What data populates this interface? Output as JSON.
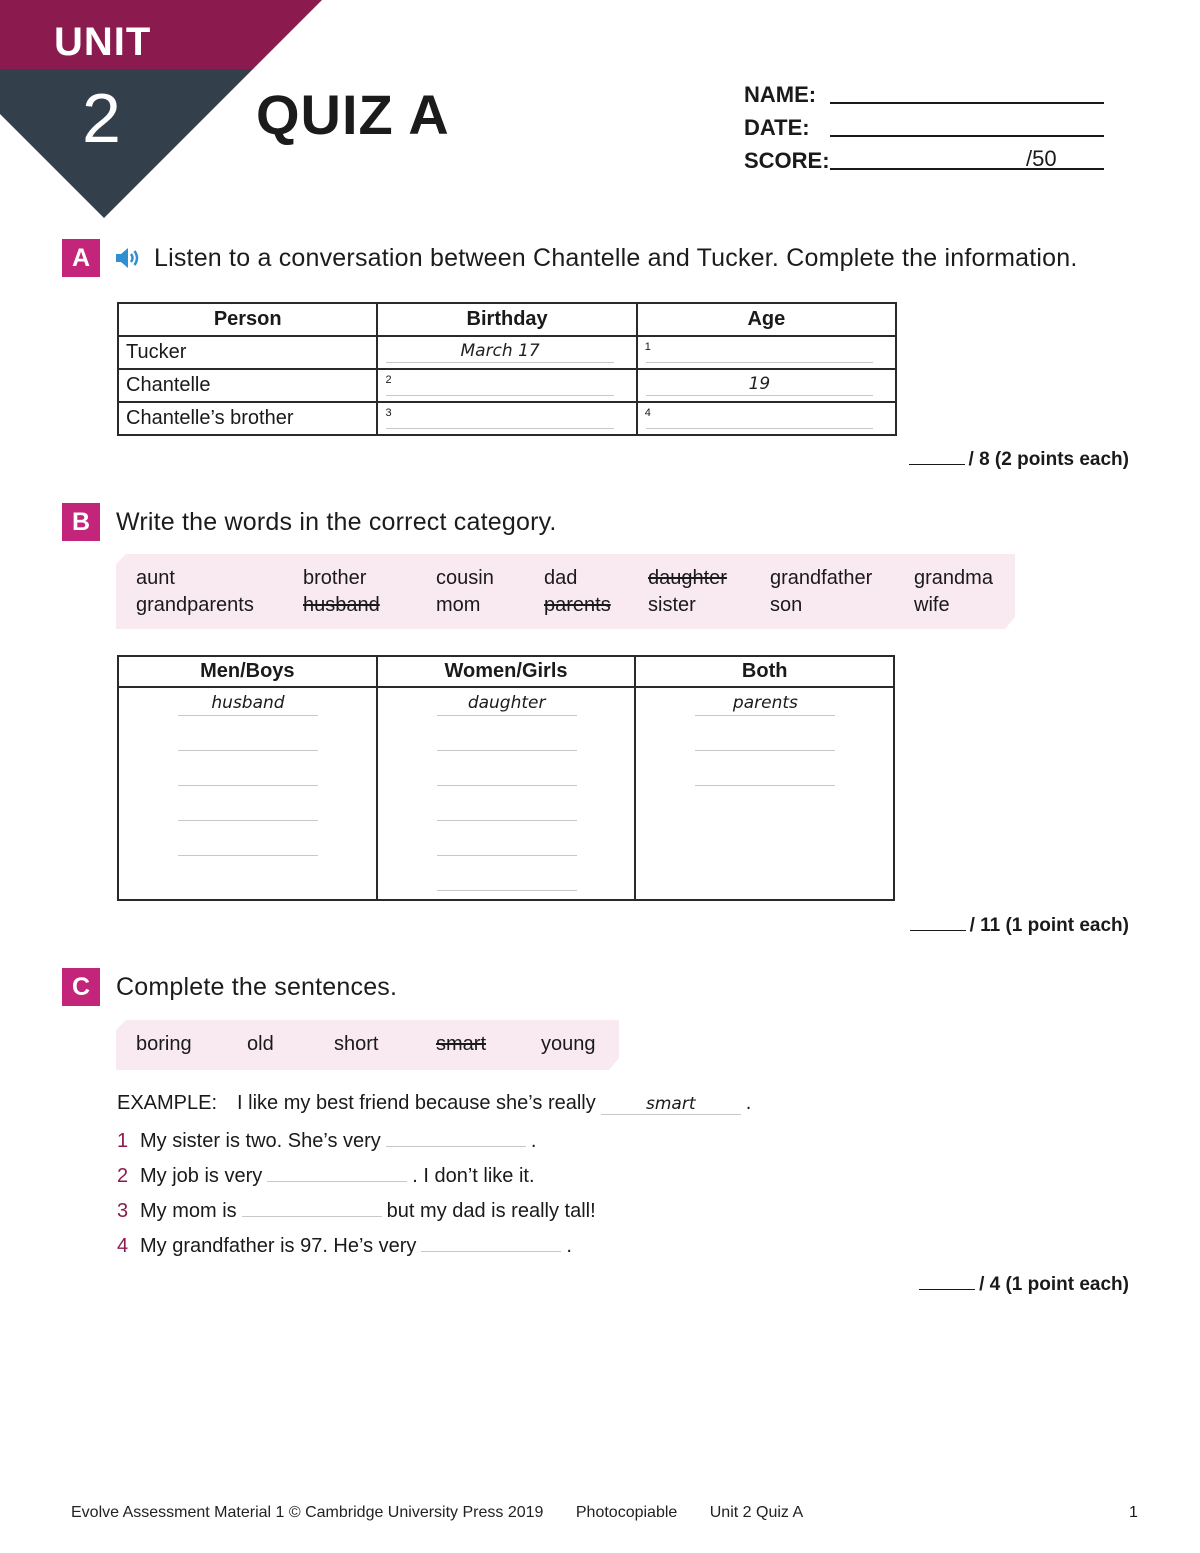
{
  "header": {
    "unit_label": "UNIT",
    "unit_number": "2",
    "quiz_title": "QUIZ A",
    "colors": {
      "unit_banner": "#8b1a4f",
      "number_banner": "#333f4b",
      "section_badge": "#c2257a",
      "word_box": "#f9e9f1"
    },
    "fields": {
      "name_label": "NAME:",
      "date_label": "DATE:",
      "score_label": "SCORE:",
      "score_max": "/50"
    }
  },
  "sectionA": {
    "letter": "A",
    "icon": "speaker-icon",
    "instruction": "Listen to a conversation between Chantelle and Tucker. Complete the information.",
    "columns": [
      "Person",
      "Birthday",
      "Age"
    ],
    "rows": [
      {
        "person": "Tucker",
        "birthday": {
          "num": "",
          "value": "March 17"
        },
        "age": {
          "num": "1",
          "value": ""
        }
      },
      {
        "person": "Chantelle",
        "birthday": {
          "num": "2",
          "value": ""
        },
        "age": {
          "num": "",
          "value": "19"
        }
      },
      {
        "person": "Chantelle’s brother",
        "birthday": {
          "num": "3",
          "value": ""
        },
        "age": {
          "num": "4",
          "value": ""
        }
      }
    ],
    "score": "/ 8 (2 points each)"
  },
  "sectionB": {
    "letter": "B",
    "instruction": "Write the words in the correct category.",
    "words": [
      {
        "text": "aunt",
        "used": false
      },
      {
        "text": "brother",
        "used": false
      },
      {
        "text": "cousin",
        "used": false
      },
      {
        "text": "dad",
        "used": false
      },
      {
        "text": "daughter",
        "used": true
      },
      {
        "text": "grandfather",
        "used": false
      },
      {
        "text": "grandma",
        "used": false
      },
      {
        "text": "grandparents",
        "used": false
      },
      {
        "text": "husband",
        "used": true
      },
      {
        "text": "mom",
        "used": false
      },
      {
        "text": "parents",
        "used": true
      },
      {
        "text": "sister",
        "used": false
      },
      {
        "text": "son",
        "used": false
      },
      {
        "text": "wife",
        "used": false
      }
    ],
    "columns": [
      "Men/Boys",
      "Women/Girls",
      "Both"
    ],
    "answers": {
      "men": [
        "husband",
        "",
        "",
        "",
        ""
      ],
      "women": [
        "daughter",
        "",
        "",
        "",
        "",
        ""
      ],
      "both": [
        "parents",
        "",
        ""
      ]
    },
    "score": "/ 11 (1 point each)"
  },
  "sectionC": {
    "letter": "C",
    "instruction": "Complete the sentences.",
    "words": [
      {
        "text": "boring",
        "used": false
      },
      {
        "text": "old",
        "used": false
      },
      {
        "text": "short",
        "used": false
      },
      {
        "text": "smart",
        "used": true
      },
      {
        "text": "young",
        "used": false
      }
    ],
    "example": {
      "label": "EXAMPLE:",
      "before": "I like my best friend because she’s really",
      "answer": "smart",
      "after": "."
    },
    "sentences": [
      {
        "num": "1",
        "before": "My sister is two. She’s very",
        "after": "."
      },
      {
        "num": "2",
        "before": "My job is very",
        "after": ". I don’t like it."
      },
      {
        "num": "3",
        "before": "My mom is",
        "after": "but my dad is really tall!"
      },
      {
        "num": "4",
        "before": "My grandfather is 97. He’s very",
        "after": "."
      }
    ],
    "score": "/ 4 (1 point each)"
  },
  "footer": {
    "copyright": "Evolve Assessment Material 1 © Cambridge University Press 2019",
    "photocopiable": "Photocopiable",
    "quiz_ref": "Unit 2 Quiz A",
    "page": "1"
  }
}
